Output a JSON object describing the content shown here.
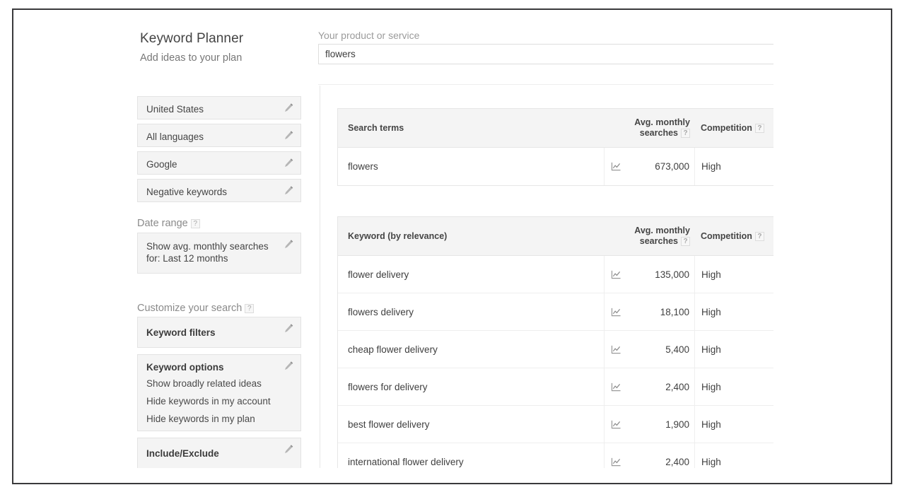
{
  "header": {
    "title": "Keyword Planner",
    "subtitle": "Add ideas to your plan",
    "product_label": "Your product or service",
    "product_value": "flowers",
    "product_placeholder": "Your product or service"
  },
  "sidebar": {
    "targeting": [
      {
        "label": "United States",
        "icon": "pencil-icon"
      },
      {
        "label": "All languages",
        "icon": "pencil-icon"
      },
      {
        "label": "Google",
        "icon": "pencil-icon"
      },
      {
        "label": "Negative keywords",
        "icon": "pencil-icon"
      }
    ],
    "date_range": {
      "heading": "Date range",
      "help": "?",
      "value_line1": "Show avg. monthly searches",
      "value_line2": "for: Last 12 months"
    },
    "customize": {
      "heading": "Customize your search",
      "help": "?",
      "keyword_filters": "Keyword filters",
      "keyword_options_title": "Keyword options",
      "keyword_options": [
        "Show broadly related ideas",
        "Hide keywords in my account",
        "Hide keywords in my plan"
      ],
      "include_exclude": "Include/Exclude"
    }
  },
  "search_terms_table": {
    "columns": {
      "term": "Search terms",
      "avg_line1": "Avg. monthly",
      "avg_line2": "searches",
      "avg_help": "?",
      "competition": "Competition",
      "competition_help": "?"
    },
    "rows": [
      {
        "term": "flowers",
        "chart_icon": "line-chart-icon",
        "avg_monthly_searches": "673,000",
        "competition": "High"
      }
    ]
  },
  "keyword_ideas_table": {
    "columns": {
      "keyword": "Keyword (by relevance)",
      "avg_line1": "Avg. monthly",
      "avg_line2": "searches",
      "avg_help": "?",
      "competition": "Competition",
      "competition_help": "?"
    },
    "rows": [
      {
        "keyword": "flower delivery",
        "chart_icon": "line-chart-icon",
        "avg_monthly_searches": "135,000",
        "competition": "High"
      },
      {
        "keyword": "flowers delivery",
        "chart_icon": "line-chart-icon",
        "avg_monthly_searches": "18,100",
        "competition": "High"
      },
      {
        "keyword": "cheap flower delivery",
        "chart_icon": "line-chart-icon",
        "avg_monthly_searches": "5,400",
        "competition": "High"
      },
      {
        "keyword": "flowers for delivery",
        "chart_icon": "line-chart-icon",
        "avg_monthly_searches": "2,400",
        "competition": "High"
      },
      {
        "keyword": "best flower delivery",
        "chart_icon": "line-chart-icon",
        "avg_monthly_searches": "1,900",
        "competition": "High"
      },
      {
        "keyword": "international flower delivery",
        "chart_icon": "line-chart-icon",
        "avg_monthly_searches": "2,400",
        "competition": "High"
      }
    ]
  },
  "colors": {
    "frame": "#3a3a3c",
    "panel_bg": "#f4f4f4",
    "border": "#e6e6e6",
    "text": "#3f3f3f",
    "muted": "#8a8a8a"
  }
}
